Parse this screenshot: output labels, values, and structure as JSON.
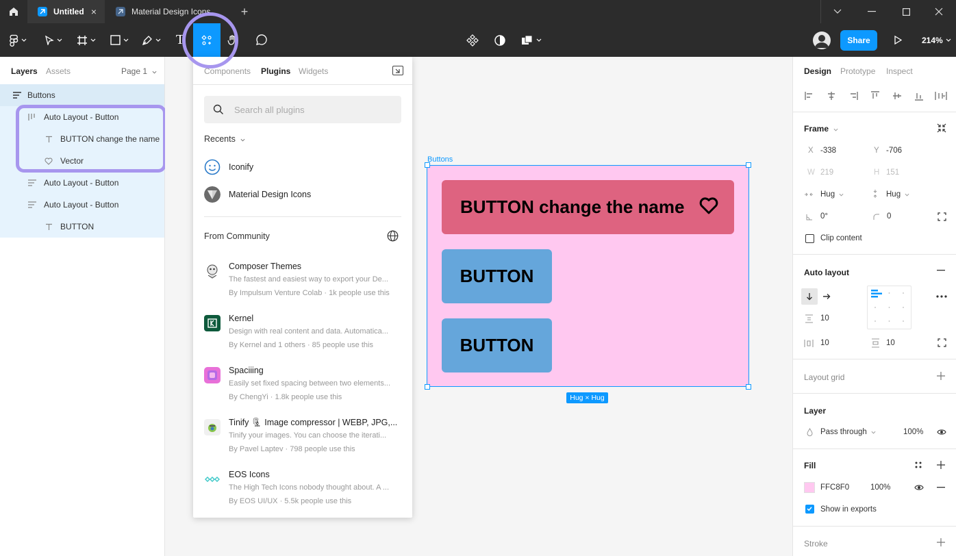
{
  "titlebar": {
    "tabs": [
      {
        "label": "Untitled",
        "close": "×"
      },
      {
        "label": "Material Design Icons"
      }
    ],
    "plus": "+"
  },
  "toolbar": {
    "share_label": "Share",
    "zoom": "214%",
    "text_tool": "T"
  },
  "left_panel": {
    "tabs": [
      "Layers",
      "Assets"
    ],
    "page": "Page 1",
    "layers": [
      {
        "label": "Buttons",
        "icon": "auto-layout-vertical-icon"
      },
      {
        "label": "Auto Layout - Button",
        "icon": "auto-layout-horizontal-icon"
      },
      {
        "label": "BUTTON change the name",
        "icon": "text-icon"
      },
      {
        "label": "Vector",
        "icon": "heart-icon"
      },
      {
        "label": "Auto Layout - Button",
        "icon": "auto-layout-vertical-icon"
      },
      {
        "label": "Auto Layout - Button",
        "icon": "auto-layout-vertical-icon"
      },
      {
        "label": "BUTTON",
        "icon": "text-icon"
      }
    ]
  },
  "plugins_popup": {
    "tabs": [
      "Components",
      "Plugins",
      "Widgets"
    ],
    "search_placeholder": "Search all plugins",
    "recents_label": "Recents",
    "recents": [
      {
        "label": "Iconify"
      },
      {
        "label": "Material Design Icons"
      }
    ],
    "community_label": "From Community",
    "community": [
      {
        "title": "Composer Themes",
        "desc": "The fastest and easiest way to export your De...",
        "by": "By Impulsum Venture Colab · 1k people use this"
      },
      {
        "title": "Kernel",
        "desc": "Design with real content and data. Automatica...",
        "by": "By Kernel and 1 others · 85 people use this"
      },
      {
        "title": "Spaciiing",
        "desc": "Easily set fixed spacing between two elements...",
        "by": "By ChengYi · 1.8k people use this"
      },
      {
        "title": "Tinify 🗜 Image compressor | WEBP, JPG,...",
        "desc": "Tinify your images. You can choose the iterati...",
        "by": "By Pavel Laptev · 798 people use this"
      },
      {
        "title": "EOS Icons",
        "desc": "The High Tech Icons nobody thought about. A ...",
        "by": "By EOS UI/UX · 5.5k people use this"
      }
    ]
  },
  "canvas": {
    "frame_label": "Buttons",
    "buttons": [
      "BUTTON change the name",
      "BUTTON",
      "BUTTON"
    ],
    "hug_badge": "Hug × Hug",
    "frame_fill": "#ffc8f0",
    "red_fill": "#de6380",
    "blue_fill": "#65a6db"
  },
  "right_panel": {
    "tabs": [
      "Design",
      "Prototype",
      "Inspect"
    ],
    "frame": {
      "title": "Frame",
      "x_label": "X",
      "x": "-338",
      "y_label": "Y",
      "y": "-706",
      "w_label": "W",
      "w": "219",
      "h_label": "H",
      "h": "151",
      "hug_w": "Hug",
      "hug_h": "Hug",
      "rotation": "0°",
      "radius": "0",
      "clip_content": "Clip content"
    },
    "auto_layout": {
      "title": "Auto layout",
      "spacing": "10",
      "padding_h": "10",
      "padding_v": "10"
    },
    "layout_grid": "Layout grid",
    "layer": {
      "title": "Layer",
      "blend": "Pass through",
      "opacity": "100%"
    },
    "fill": {
      "title": "Fill",
      "hex": "FFC8F0",
      "opacity": "100%",
      "show_in_exports": "Show in exports"
    },
    "stroke": "Stroke"
  },
  "colors": {
    "accent": "#0d99ff",
    "annotation": "#a796ee",
    "toolbar_bg": "#2c2c2c"
  }
}
